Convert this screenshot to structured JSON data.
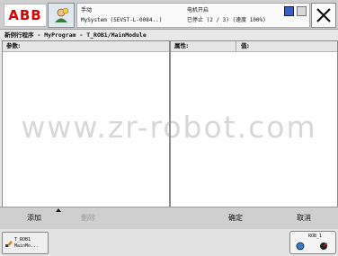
{
  "header": {
    "logo_text": "ABB",
    "status_line1_left": "手动",
    "status_line2_left": "MySystem (SEV5T-L-0084..)",
    "status_line1_right": "电机开启",
    "status_line2_right": "已停止 (2 / 3) (速度 100%)"
  },
  "title": "新例行程序 - MyProgram - T_ROB1/MainModule",
  "left_panel": {
    "header": "参数:"
  },
  "right_panel": {
    "header_attr": "属性:",
    "header_value": "值:"
  },
  "watermark": "www.zr-robot.com",
  "commands": {
    "add": "添加",
    "delete": "删除",
    "ok": "确定",
    "cancel": "取消"
  },
  "taskbar": {
    "task_line1": "T_ROB1",
    "task_line2": "MainMo...",
    "quickset_label": "ROB_1"
  },
  "colors": {
    "brand": "#e00000",
    "disabled": "#9a9a9a"
  }
}
